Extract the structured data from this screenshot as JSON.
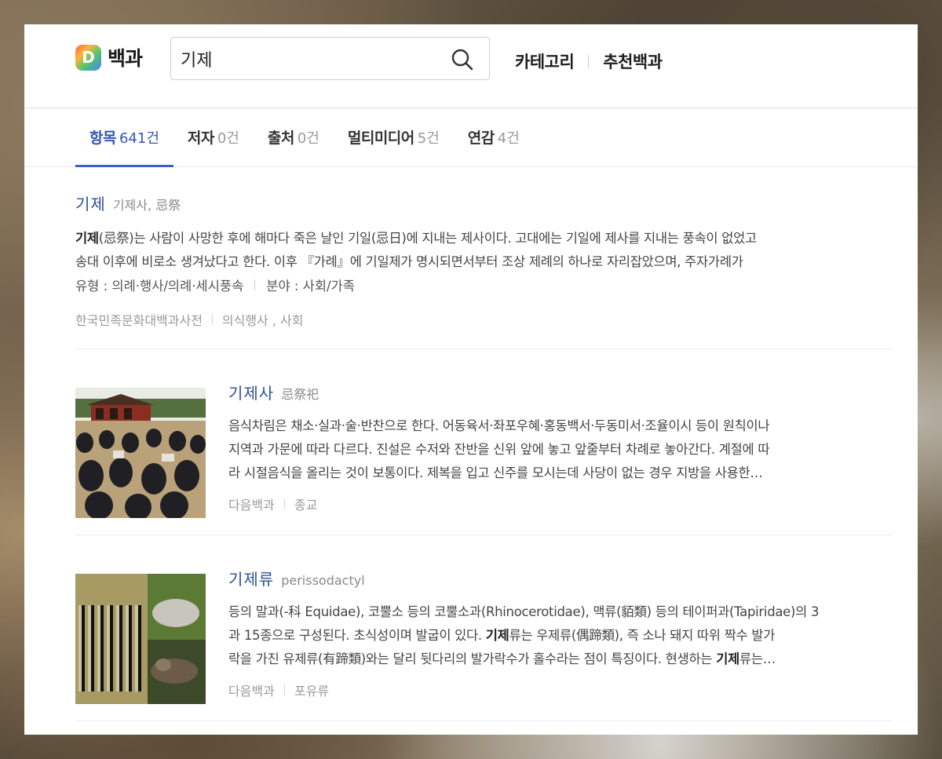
{
  "header": {
    "logo_letter": "D",
    "logo_text": "백과",
    "search_value": "기제",
    "nav": [
      "카테고리",
      "추천백과"
    ]
  },
  "tabs": [
    {
      "label": "항목",
      "count": "641건",
      "active": true
    },
    {
      "label": "저자",
      "count": "0건",
      "active": false
    },
    {
      "label": "출처",
      "count": "0건",
      "active": false
    },
    {
      "label": "멀티미디어",
      "count": "5건",
      "active": false
    },
    {
      "label": "연감",
      "count": "4건",
      "active": false
    }
  ],
  "results": [
    {
      "title": "기제",
      "subtitle": "기제사, 忌祭",
      "desc_line1_bold": "기제",
      "desc_line1_rest": "(忌祭)는 사람이 사망한 후에 해마다 죽은 날인 기일(忌日)에 지내는 제사이다. 고대에는 기일에 제사를 지내는 풍속이 없었고",
      "desc_line2": "송대 이후에 비로소 생겨났다고 한다. 이후 『가례』에 기일제가 명시되면서부터 조상 제례의 하나로 자리잡았으며, 주자가례가",
      "meta_type": "유형 : 의례·행사/의례·세시풍속",
      "meta_field": "분야 : 사회/가족",
      "source": "한국민족문화대백과사전",
      "category": "의식행사 , 사회"
    },
    {
      "title": "기제사",
      "subtitle": "忌祭祀",
      "desc_line1": "음식차림은 채소·실과·술·반찬으로 한다. 어동육서·좌포우혜·홍동백서·두동미서·조율이시 등이 원칙이나",
      "desc_line2": "지역과 가문에 따라 다르다. 진설은 수저와 잔반을 신위 앞에 놓고 앞줄부터 차례로 놓아간다. 계절에 따",
      "desc_line3": "라 시절음식을 올리는 것이 보통이다. 제복을 입고 신주를 모시는데 사당이 없는 경우 지방을 사용한…",
      "source": "다음백과",
      "category": "종교"
    },
    {
      "title": "기제류",
      "subtitle": "perissodactyl",
      "desc_line1": "등의 말과(-科 Equidae), 코뿔소 등의 코뿔소과(Rhinocerotidae), 맥류(貊類) 등의 테이퍼과(Tapiridae)의 3",
      "desc_line2_a": "과 15종으로 구성된다. 초식성이며 발굽이 있다. ",
      "desc_line2_bold": "기제",
      "desc_line2_b": "류는 우제류(偶蹄類), 즉 소나 돼지 따위 짝수 발가",
      "desc_line3_a": "락을 가진 유제류(有蹄類)와는 달리 뒷다리의 발가락수가 홀수라는 점이 특징이다. 현생하는 ",
      "desc_line3_bold": "기제",
      "desc_line3_b": "류는…",
      "source": "다음백과",
      "category": "포유류"
    }
  ],
  "colors": {
    "accent": "#3b5fc4",
    "title_link": "#2d4f9b"
  }
}
